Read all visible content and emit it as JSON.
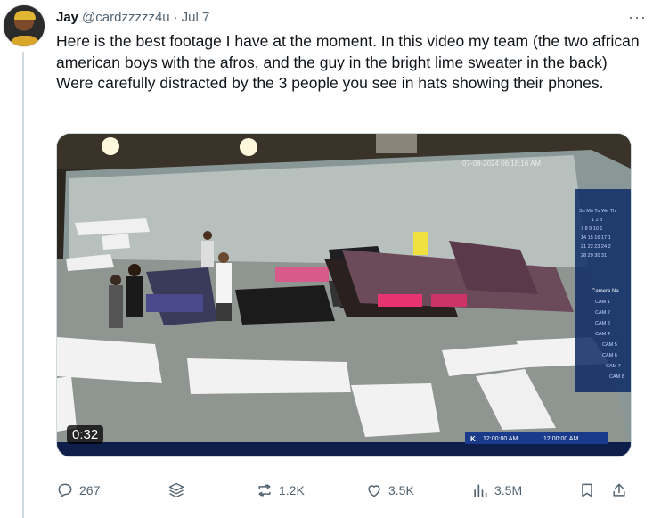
{
  "tweet": {
    "author_name": "Jay",
    "handle": "@cardzzzzz4u",
    "separator": "·",
    "date": "Jul 7",
    "more_label": "···",
    "text": "Here is the best footage I have at the moment. In this video my team (the two african american boys with the afros, and the guy in the bright lime sweater in the back) Were carefully distracted by the 3 people you see in hats showing their phones."
  },
  "media": {
    "duration": "0:32",
    "cctv_timestamp": "07-08-2024 06:18:16 AM",
    "camera_panel_title": "Camera Na",
    "cameras": [
      "CAM 1",
      "CAM 2",
      "CAM 3",
      "CAM 4",
      "CAM 5",
      "CAM 6",
      "CAM 7",
      "CAM 8"
    ],
    "calendar_header": "Su Mo Tu We Th",
    "calendar_rows": [
      "1  2  3",
      "7  8  9  10  1",
      "14 15 16 17 1",
      "21 22 23 24 2",
      "28 29 30 31"
    ],
    "timeline_start": "12:00:00 AM",
    "timeline_end": "12:00:00 AM",
    "timeline_mark": "K"
  },
  "actions": {
    "replies": "267",
    "reposts": "1.2K",
    "likes": "3.5K",
    "views": "3.5M"
  }
}
